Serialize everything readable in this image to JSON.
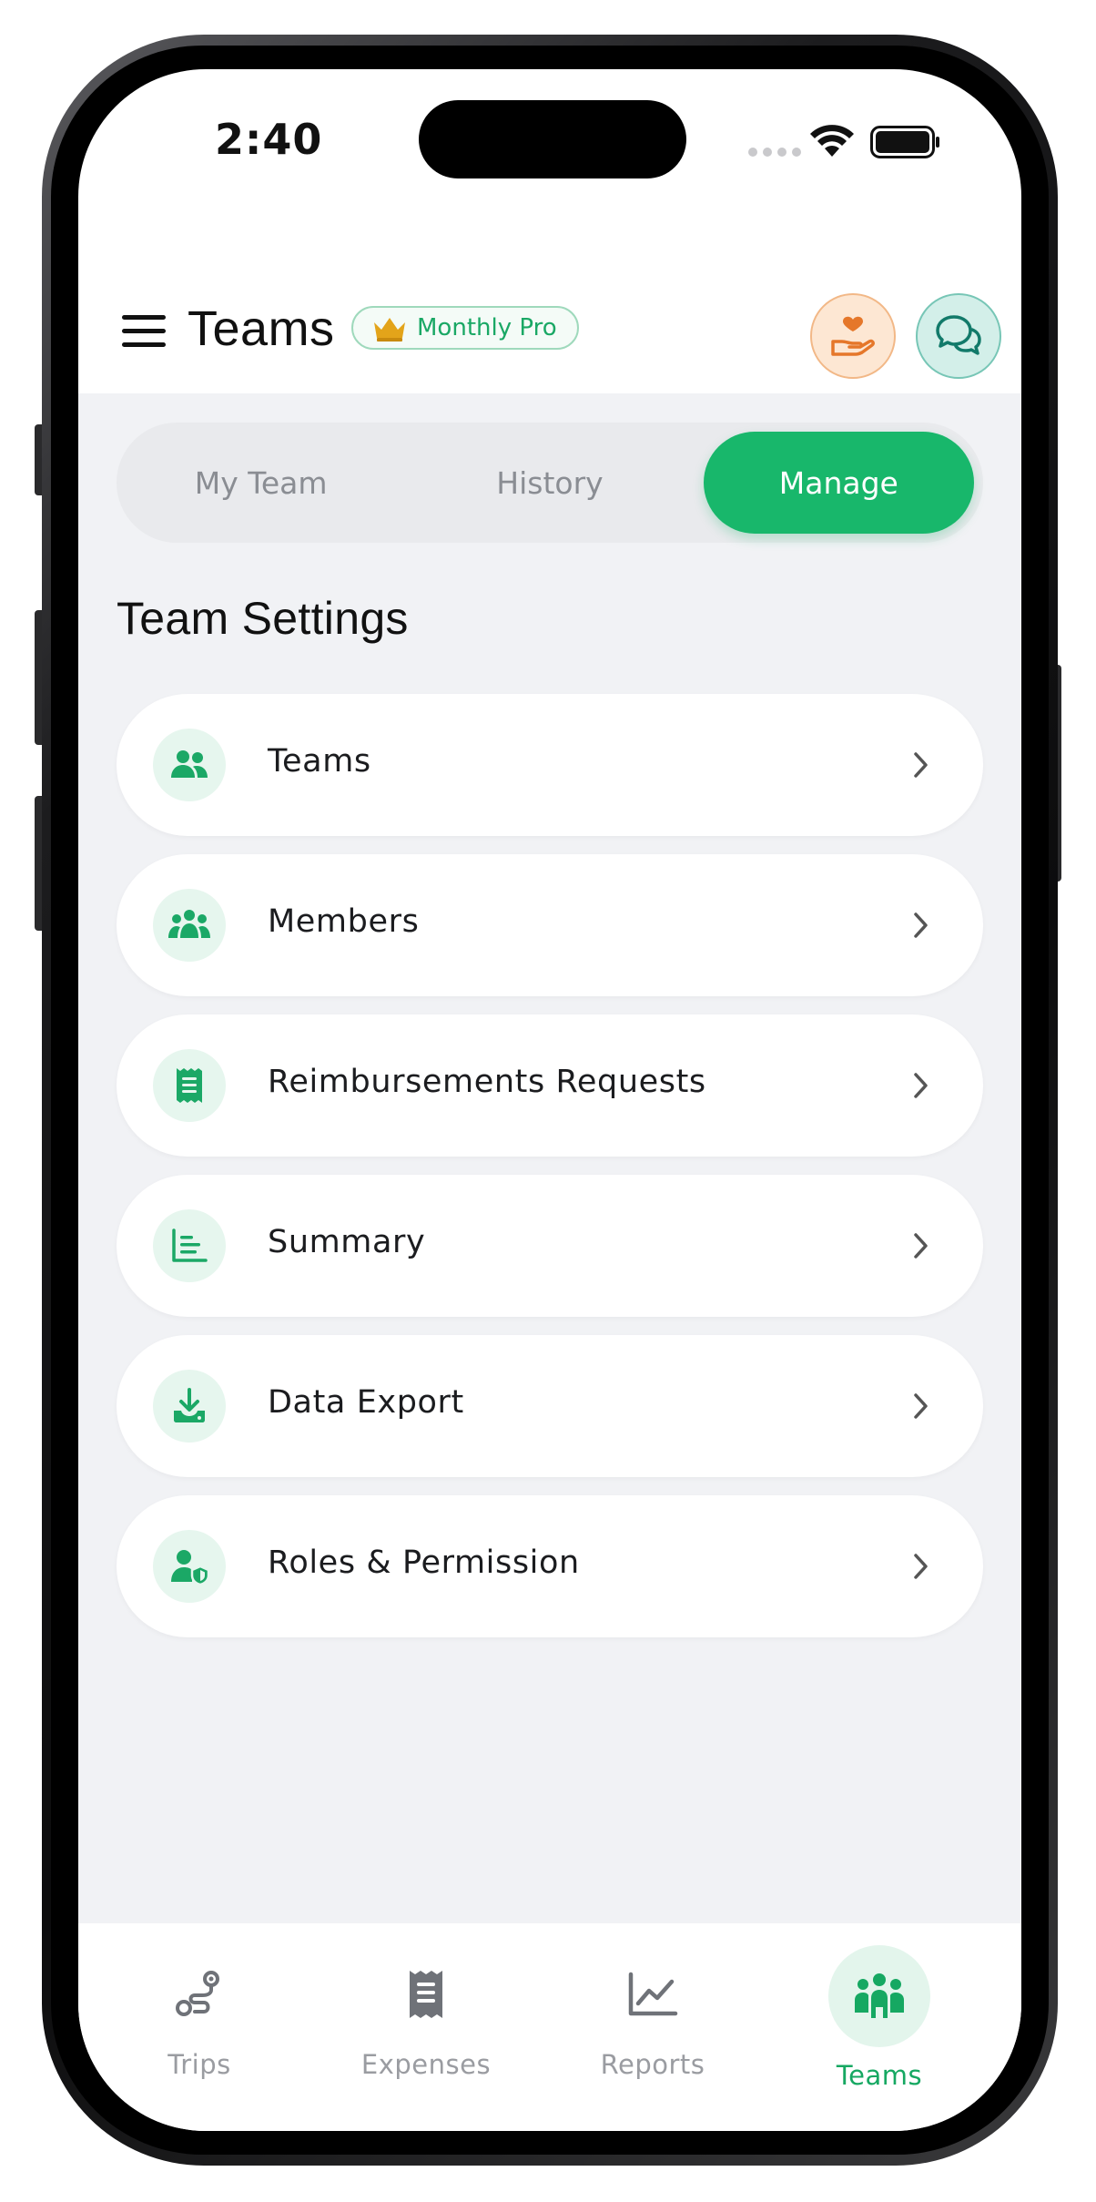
{
  "status_bar": {
    "time": "2:40"
  },
  "header": {
    "title": "Teams",
    "badge": "Monthly Pro",
    "icons": {
      "menu": "hamburger-icon",
      "donate": "hand-heart-icon",
      "chat": "chat-bubbles-icon"
    }
  },
  "segments": {
    "items": [
      {
        "label": "My Team",
        "active": false
      },
      {
        "label": "History",
        "active": false
      },
      {
        "label": "Manage",
        "active": true
      }
    ]
  },
  "section": {
    "title": "Team Settings"
  },
  "settings": {
    "items": [
      {
        "label": "Teams",
        "icon": "users-icon"
      },
      {
        "label": "Members",
        "icon": "group-icon"
      },
      {
        "label": "Reimbursements Requests",
        "icon": "receipt-icon"
      },
      {
        "label": "Summary",
        "icon": "list-chart-icon"
      },
      {
        "label": "Data Export",
        "icon": "download-icon"
      },
      {
        "label": "Roles & Permission",
        "icon": "user-shield-icon"
      }
    ]
  },
  "tabbar": {
    "items": [
      {
        "label": "Trips",
        "icon": "route-icon",
        "active": false
      },
      {
        "label": "Expenses",
        "icon": "receipt-icon",
        "active": false
      },
      {
        "label": "Reports",
        "icon": "line-chart-icon",
        "active": false
      },
      {
        "label": "Teams",
        "icon": "people-icon",
        "active": true
      }
    ]
  },
  "colors": {
    "accent": "#18b76b",
    "background": "#f1f2f5",
    "badge_text": "#1aa865"
  }
}
